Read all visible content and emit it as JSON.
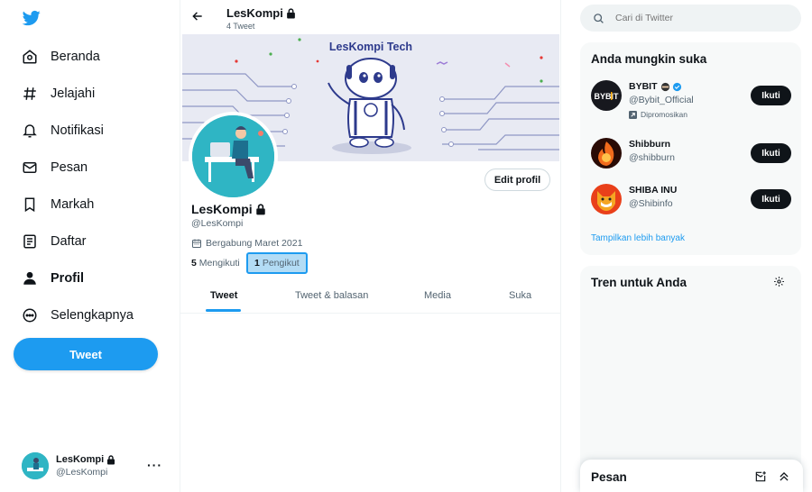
{
  "nav": {
    "items": [
      {
        "label": "Beranda",
        "icon": "home-icon"
      },
      {
        "label": "Jelajahi",
        "icon": "hashtag-icon"
      },
      {
        "label": "Notifikasi",
        "icon": "bell-icon"
      },
      {
        "label": "Pesan",
        "icon": "envelope-icon"
      },
      {
        "label": "Markah",
        "icon": "bookmark-icon"
      },
      {
        "label": "Daftar",
        "icon": "list-icon"
      },
      {
        "label": "Profil",
        "icon": "person-icon"
      },
      {
        "label": "Selengkapnya",
        "icon": "more-circle-icon"
      }
    ],
    "active": "Profil",
    "tweet_button": "Tweet"
  },
  "account": {
    "name": "LesKompi",
    "handle": "@LesKompi",
    "more": "···"
  },
  "profile": {
    "top_name": "LesKompi",
    "tweet_count": "4 Tweet",
    "banner_title": "LesKompi Tech",
    "name": "LesKompi",
    "handle": "@LesKompi",
    "joined": "Bergabung Maret 2021",
    "following_count": "5",
    "following_label": "Mengikuti",
    "followers_count": "1",
    "followers_label": "Pengikut",
    "edit_button": "Edit profil"
  },
  "tabs": [
    {
      "label": "Tweet",
      "active": true
    },
    {
      "label": "Tweet & balasan",
      "active": false
    },
    {
      "label": "Media",
      "active": false
    },
    {
      "label": "Suka",
      "active": false
    }
  ],
  "search": {
    "placeholder": "Cari di Twitter"
  },
  "suggestions": {
    "title": "Anda mungkin suka",
    "items": [
      {
        "name": "BYBIT",
        "handle": "@Bybit_Official",
        "promoted": "Dipromosikan",
        "button": "Ikuti"
      },
      {
        "name": "Shibburn",
        "handle": "@shibburn",
        "button": "Ikuti"
      },
      {
        "name": "SHIBA INU",
        "handle": "@Shibinfo",
        "button": "Ikuti"
      }
    ],
    "show_more": "Tampilkan lebih banyak"
  },
  "trends": {
    "title": "Tren untuk Anda"
  },
  "messages": {
    "title": "Pesan"
  },
  "colors": {
    "accent": "#1d9bf0",
    "text": "#0f1419",
    "muted": "#536471",
    "card_bg": "#f7f9f9"
  }
}
